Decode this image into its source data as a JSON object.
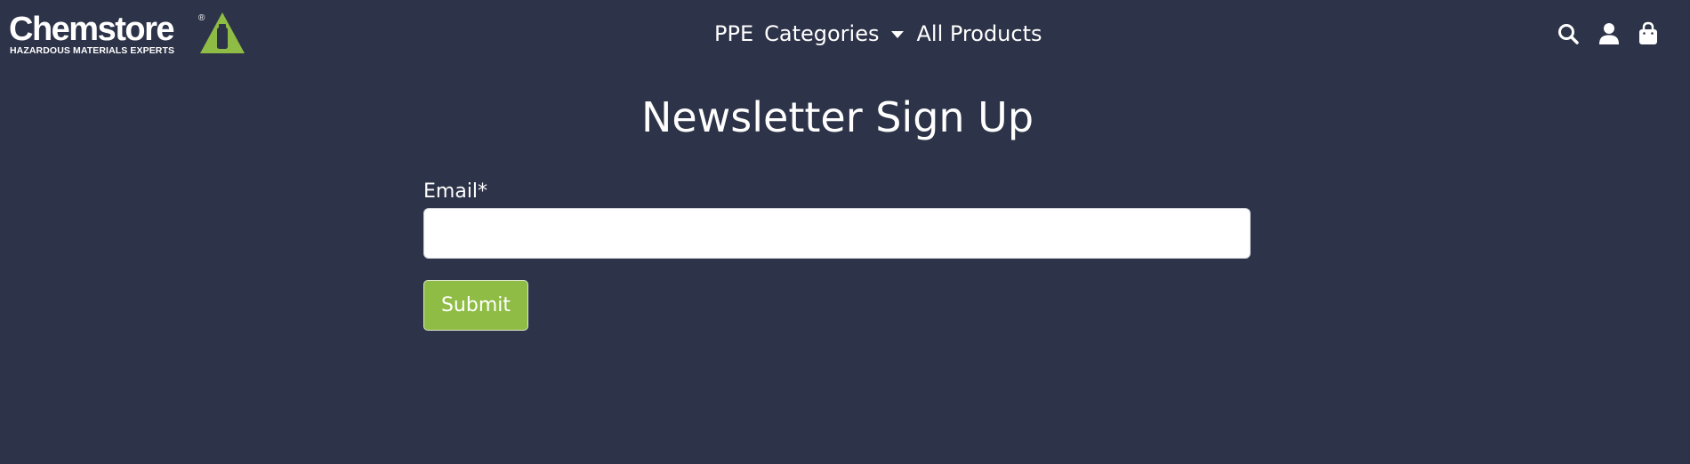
{
  "brand": {
    "logo_text": "Chemstore",
    "registered_mark": "®",
    "tagline": "HAZARDOUS MATERIALS EXPERTS",
    "accent_color": "#8fbc45"
  },
  "nav": {
    "items": [
      {
        "label": "PPE"
      },
      {
        "label": "Categories",
        "has_dropdown": true
      },
      {
        "label": "All Products"
      }
    ]
  },
  "header_icons": [
    "search-icon",
    "account-icon",
    "cart-icon"
  ],
  "page": {
    "title": "Newsletter Sign Up"
  },
  "form": {
    "email_label": "Email*",
    "email_value": "",
    "email_placeholder": "",
    "submit_label": "Submit"
  },
  "colors": {
    "background": "#2d3348",
    "text": "#ffffff",
    "button": "#8fbc45"
  }
}
